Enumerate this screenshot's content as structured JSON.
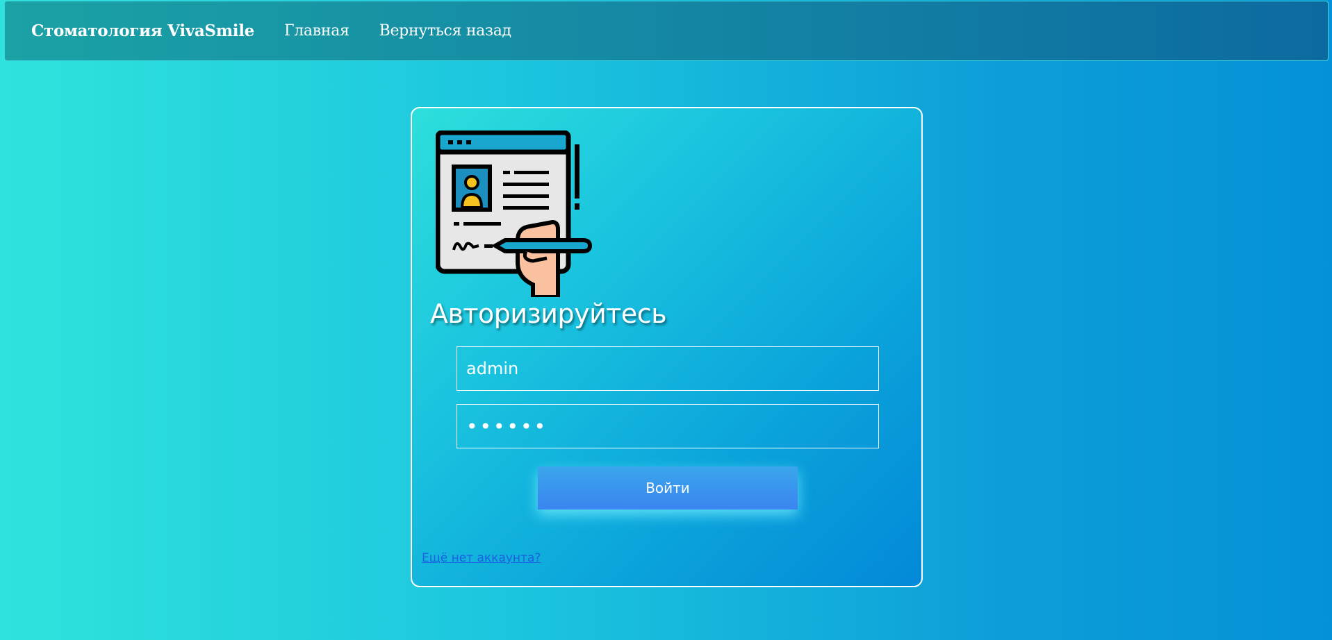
{
  "navbar": {
    "brand": "Стоматология VivaSmile",
    "links": [
      "Главная",
      "Вернуться назад"
    ]
  },
  "login": {
    "title": "Авторизируйтесь",
    "username_value": "admin",
    "password_value": "••••••",
    "submit_label": "Войти",
    "register_link": "Ещё нет аккаунта?"
  },
  "colors": {
    "accent_button": "#3b85f0",
    "link": "#1a62e0",
    "navbar_start": "#1ba2a5",
    "navbar_end": "#0d6aa0"
  },
  "icons": {
    "illustration": "signing-document-illustration"
  }
}
